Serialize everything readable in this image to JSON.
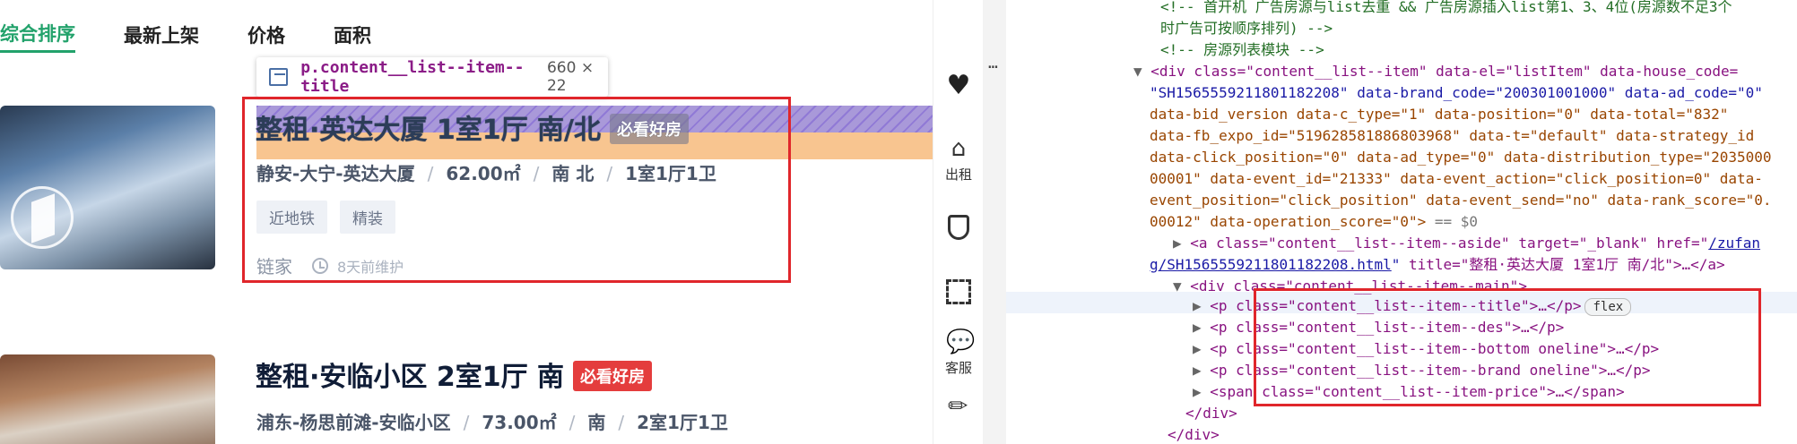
{
  "tabs": [
    {
      "label": "综合排序",
      "active": true
    },
    {
      "label": "最新上架",
      "active": false
    },
    {
      "label": "价格",
      "active": false
    },
    {
      "label": "面积",
      "active": false
    }
  ],
  "tooltip": {
    "selector": "p.content__list--item--title",
    "size": "660 × 22"
  },
  "listings": [
    {
      "title": "整租·英达大厦 1室1厅 南/北",
      "badge": "必看好房",
      "desc": [
        "静安-大宁-英达大厦",
        "62.00㎡",
        "南 北",
        "1室1厅1卫"
      ],
      "tags": [
        "近地铁",
        "精装"
      ],
      "brand": "链家",
      "time": "8天前维护"
    },
    {
      "title": "整租·安临小区 2室1厅 南",
      "badge": "必看好房",
      "desc": [
        "浦东-杨思前滩-安临小区",
        "73.00㎡",
        "南",
        "2室1厅1卫"
      ]
    }
  ],
  "sidebar": {
    "items": [
      {
        "icon": "heart-icon",
        "label": ""
      },
      {
        "icon": "rent-icon",
        "label": "出租"
      },
      {
        "icon": "shield-icon",
        "label": ""
      },
      {
        "icon": "scan-icon",
        "label": ""
      },
      {
        "icon": "chat-icon",
        "label": "客服"
      },
      {
        "icon": "edit-icon",
        "label": ""
      }
    ]
  },
  "devtools": {
    "comment1a": "<!-- 首开机 广告房源与list去重 && 广告房源插入list第1、3、4位(房源数不足3个",
    "comment1b": "时广告可按顺序排列) -->",
    "comment2": "<!-- 房源列表模块 -->",
    "el_line1": "<div class=\"content__list--item\" data-el=\"listItem\" data-house_code=",
    "el_line2": "\"SH1565559211801182208\" data-brand_code=\"200301001000\" data-ad_code=\"0\"",
    "el_line3": "data-bid_version data-c_type=\"1\" data-position=\"0\" data-total=\"832\"",
    "el_line4": "data-fb_expo_id=\"519628581886803968\" data-t=\"default\" data-strategy_id",
    "el_line5": "data-click_position=\"0\" data-ad_type=\"0\" data-distribution_type=\"2035000",
    "el_line6": "00001\" data-event_id=\"21333\" data-event_action=\"click_position=0\" data-",
    "el_line7": "event_position=\"click_position\" data-event_send=\"no\" data-rank_score=\"0.",
    "el_line8a": "00012\" data-operation_score=\"0\">",
    "el_line8b": "== $0",
    "a_line1": "<a class=\"content__list--item--aside\" target=\"_blank\" href=\"",
    "a_link1": "/zufan",
    "a_link2": "g/SH1565559211801182208.html",
    "a_line2b": " title=\"整租·英达大厦 1室1厅 南/北\">…</a>",
    "main_div": "<div class=\"content__list--item--main\">",
    "p_title": "<p class=\"content__list--item--title\">…</p>",
    "flex_badge": "flex",
    "p_des": "<p class=\"content__list--item--des\">…</p>",
    "p_bottom": "<p class=\"content__list--item--bottom oneline\">…</p>",
    "p_brand": "<p class=\"content__list--item--brand oneline\">…</p>",
    "span_price": "<span class=\"content__list--item-price\">…</span>",
    "close_div1": "</div>",
    "close_div2": "</div>",
    "dots": "…"
  }
}
